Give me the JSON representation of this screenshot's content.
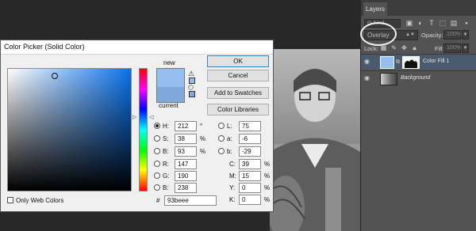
{
  "layers_panel": {
    "tab_label": "Layers",
    "kind_select": "Ꮎ Kind",
    "blend_mode": "Overlay",
    "opacity_label": "Opacity:",
    "opacity_value": "100%",
    "lock_label": "Lock:",
    "fill_label": "Fill:",
    "fill_value": "100%",
    "layers": [
      {
        "name": "Color Fill 1",
        "selected": true
      },
      {
        "name": "Background",
        "selected": false
      }
    ]
  },
  "dialog": {
    "title": "Color Picker (Solid Color)",
    "new_label": "new",
    "current_label": "current",
    "ok_label": "OK",
    "cancel_label": "Cancel",
    "add_swatches_label": "Add to Swatches",
    "color_libraries_label": "Color Libraries",
    "only_web_colors_label": "Only Web Colors",
    "hsb": [
      {
        "label": "H:",
        "value": "212",
        "unit": "°",
        "checked": true
      },
      {
        "label": "S:",
        "value": "38",
        "unit": "%",
        "checked": false
      },
      {
        "label": "B:",
        "value": "93",
        "unit": "%",
        "checked": false
      }
    ],
    "rgb": [
      {
        "label": "R:",
        "value": "147"
      },
      {
        "label": "G:",
        "value": "190"
      },
      {
        "label": "B:",
        "value": "238"
      }
    ],
    "lab": [
      {
        "label": "L:",
        "value": "75"
      },
      {
        "label": "a:",
        "value": "-6"
      },
      {
        "label": "b:",
        "value": "-29"
      }
    ],
    "cmyk": [
      {
        "label": "C:",
        "value": "39",
        "unit": "%"
      },
      {
        "label": "M:",
        "value": "15",
        "unit": "%"
      },
      {
        "label": "Y:",
        "value": "0",
        "unit": "%"
      },
      {
        "label": "K:",
        "value": "0",
        "unit": "%"
      }
    ],
    "hex_symbol": "#",
    "hex_value": "93beee",
    "new_color": "#93beee",
    "current_color": "#7fa8db"
  }
}
